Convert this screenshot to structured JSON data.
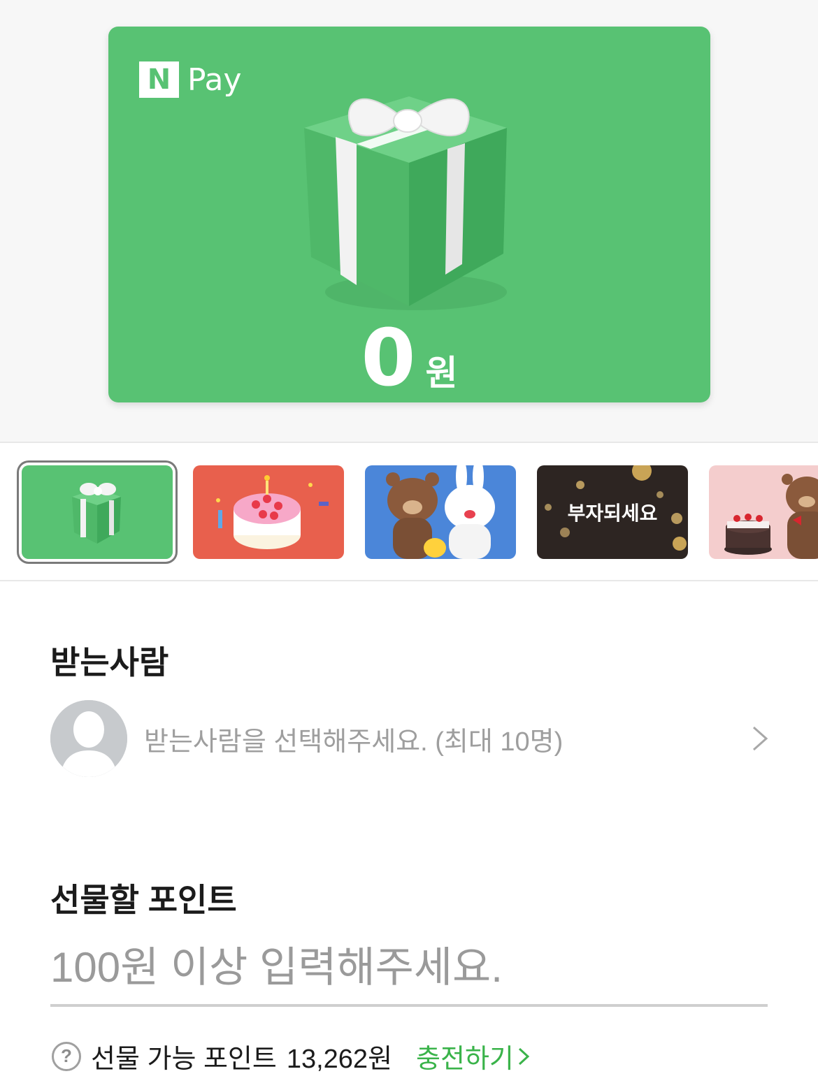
{
  "card": {
    "logo_letter": "N",
    "logo_text": "Pay",
    "amount": "0",
    "unit": "원",
    "color": "#58c273"
  },
  "themes": [
    {
      "name": "gift-box",
      "selected": true
    },
    {
      "name": "birthday-cake",
      "selected": false
    },
    {
      "name": "line-friends",
      "selected": false
    },
    {
      "name": "get-rich",
      "label": "부자되세요",
      "selected": false
    },
    {
      "name": "bear-cake",
      "selected": false
    }
  ],
  "recipient": {
    "title": "받는사람",
    "placeholder": "받는사람을 선택해주세요. (최대 10명)"
  },
  "points": {
    "title": "선물할 포인트",
    "placeholder": "100원 이상 입력해주세요.",
    "available_label": "선물 가능 포인트",
    "available_value": "13,262원",
    "charge_label": "충전하기",
    "help_icon": "?"
  },
  "colors": {
    "accent_green": "#3ab34a",
    "card_green": "#58c273"
  }
}
